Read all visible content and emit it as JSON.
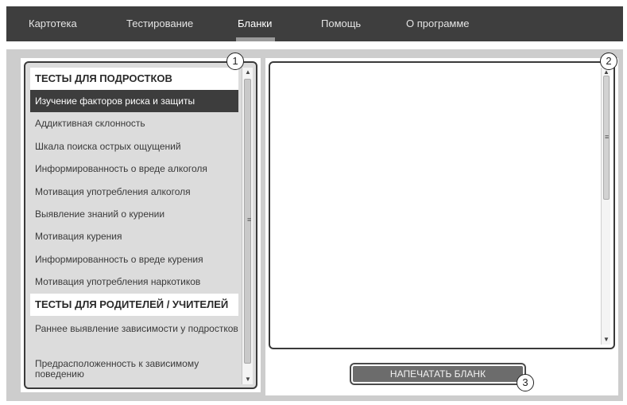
{
  "nav": {
    "tabs": [
      {
        "label": "Картотека"
      },
      {
        "label": "Тестирование"
      },
      {
        "label": "Бланки"
      },
      {
        "label": "Помощь"
      },
      {
        "label": "О программе"
      }
    ],
    "active_tab": "Бланки"
  },
  "test_list": {
    "group1_header": "ТЕСТЫ ДЛЯ ПОДРОСТКОВ",
    "group1_items": [
      "Изучение факторов риска и защиты",
      "Аддиктивная склонность",
      "Шкала поиска острых ощущений",
      "Информированность о вреде алкоголя",
      "Мотивация употребления алкоголя",
      "Выявление знаний о курении",
      "Мотивация курения",
      "Информированность о вреде курения",
      "Мотивация употребления наркотиков"
    ],
    "selected_item": "Изучение факторов риска и защиты",
    "group2_header": "ТЕСТЫ ДЛЯ РОДИТЕЛЕЙ / УЧИТЕЛЕЙ",
    "group2_items": [
      "Раннее выявление зависимости у подростков",
      "Предрасположенность к зависимому поведению"
    ]
  },
  "print_button": {
    "label": "НАПЕЧАТАТЬ БЛАНК"
  },
  "callouts": [
    "1",
    "2",
    "3"
  ],
  "colors": {
    "topbar": "#3e3e3e",
    "frame": "#cdcdcd",
    "selected_row": "#3d3d3d",
    "button": "#6c6c6c"
  }
}
